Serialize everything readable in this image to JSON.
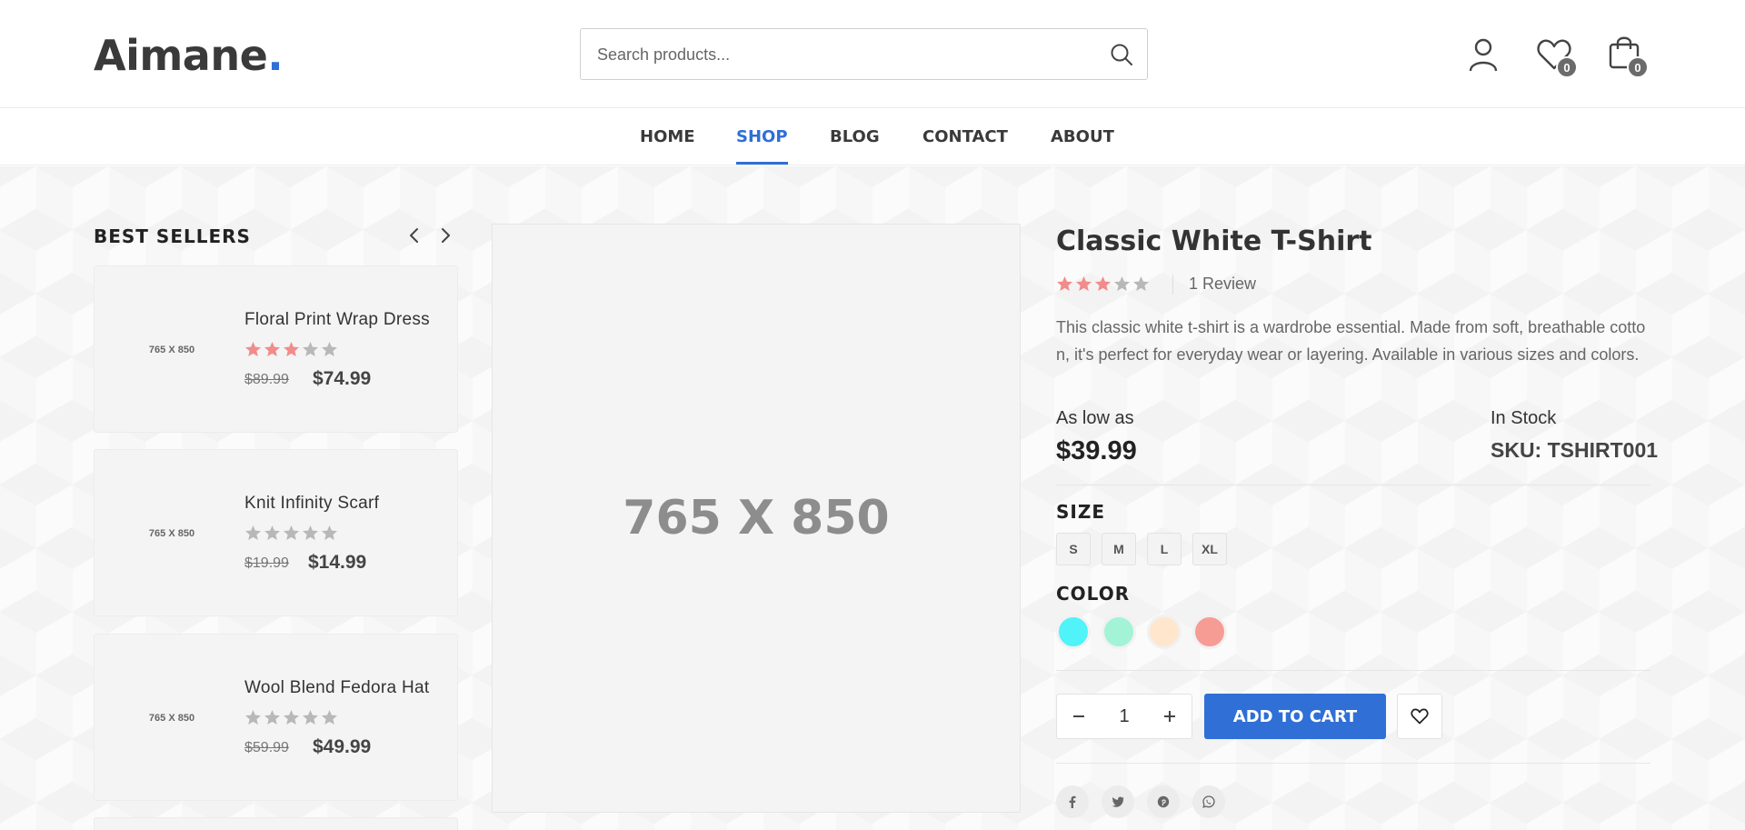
{
  "brand": {
    "name": "Aimane",
    "dot": ".",
    "accent": "#2f6fd6"
  },
  "search": {
    "placeholder": "Search products..."
  },
  "header": {
    "wishlist_count": "0",
    "cart_count": "0"
  },
  "nav": {
    "items": [
      "HOME",
      "SHOP",
      "BLOG",
      "CONTACT",
      "ABOUT"
    ],
    "active": "SHOP"
  },
  "best_sellers": {
    "title": "BEST SELLERS",
    "items": [
      {
        "thumb": "765 X 850",
        "name": "Floral Print Wrap Dress",
        "rating": 3,
        "old_price": "$89.99",
        "price": "$74.99"
      },
      {
        "thumb": "765 X 850",
        "name": "Knit Infinity Scarf",
        "rating": 0,
        "old_price": "$19.99",
        "price": "$14.99"
      },
      {
        "thumb": "765 X 850",
        "name": "Wool Blend Fedora Hat",
        "rating": 0,
        "old_price": "$59.99",
        "price": "$49.99"
      }
    ]
  },
  "product": {
    "image_label": "765 X 850",
    "title": "Classic White T-Shirt",
    "rating": 3,
    "reviews": "1 Review",
    "description": "This classic white t-shirt is a wardrobe essential. Made from soft, breathable cotton, it's perfect for everyday wear or layering. Available in various sizes and colors.",
    "price_label": "As low as",
    "price": "$39.99",
    "stock": "In Stock",
    "sku": "SKU: TSHIRT001",
    "size_label": "SIZE",
    "sizes": [
      "S",
      "M",
      "L",
      "XL"
    ],
    "color_label": "COLOR",
    "colors": [
      "#4ff3f8",
      "#a3f3d6",
      "#ffe6cc",
      "#f79c94"
    ],
    "quantity": "1",
    "add_to_cart": "ADD TO CART",
    "star_active_color": "#f28b8b",
    "star_inactive_color": "#b8b8b8"
  },
  "social_icons": [
    "facebook-icon",
    "twitter-icon",
    "pinterest-icon",
    "whatsapp-icon"
  ]
}
